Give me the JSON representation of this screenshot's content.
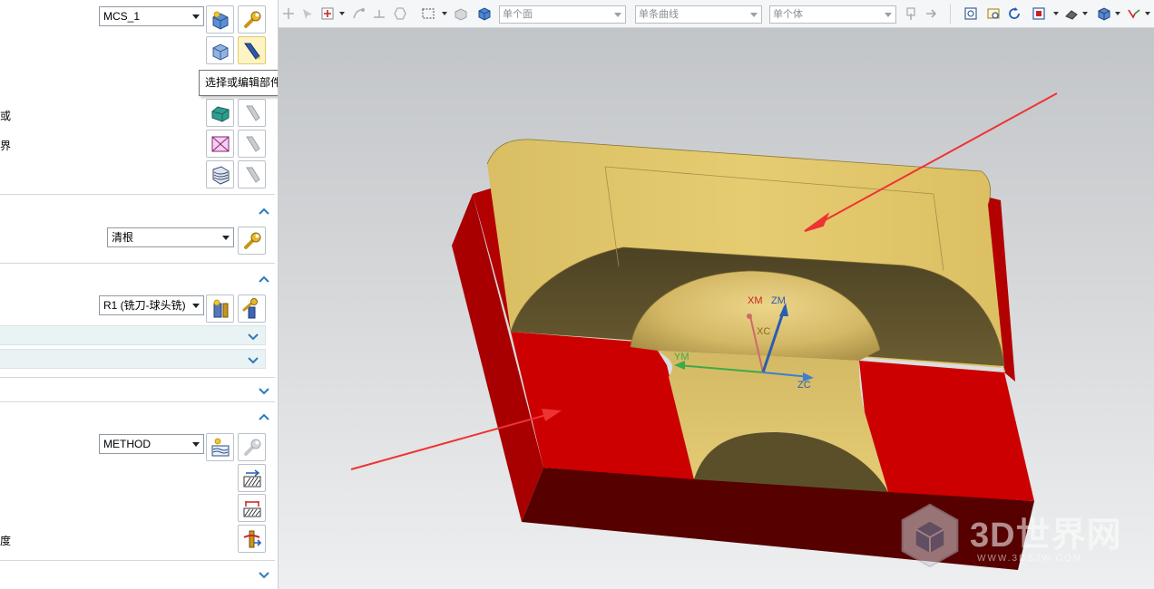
{
  "left_panel": {
    "geometry_combo": "MCS_1",
    "tooltip": "选择或编辑部件几何体",
    "label_frags": [
      "或",
      "界",
      "度"
    ],
    "method_combo_1": "清根",
    "tool_combo": "R1 (铣刀-球头铣)",
    "method_combo_2": "METHOD"
  },
  "toolbar": {
    "face_filter": "单个面",
    "curve_filter": "单条曲线",
    "body_filter": "单个体"
  },
  "viewport": {
    "axes": [
      "XM",
      "ZM",
      "XC",
      "YM",
      "ZC"
    ],
    "colors": {
      "part": "#e3c96b",
      "blank": "#cc0000",
      "arrow": "#ee3333"
    },
    "watermark": {
      "brand": "3D世界网",
      "url": "WWW.3DSJW.COM"
    }
  }
}
